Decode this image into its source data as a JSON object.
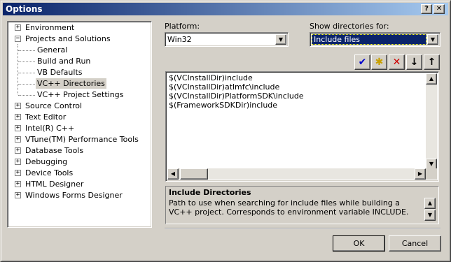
{
  "window": {
    "title": "Options",
    "help_btn": "?",
    "close_btn": "✕"
  },
  "tree": {
    "items": [
      {
        "label": "Environment",
        "expander": "+"
      },
      {
        "label": "Projects and Solutions",
        "expander": "−"
      },
      {
        "label": "General"
      },
      {
        "label": "Build and Run"
      },
      {
        "label": "VB Defaults"
      },
      {
        "label": "VC++ Directories"
      },
      {
        "label": "VC++ Project Settings"
      },
      {
        "label": "Source Control",
        "expander": "+"
      },
      {
        "label": "Text Editor",
        "expander": "+"
      },
      {
        "label": "Intel(R) C++",
        "expander": "+"
      },
      {
        "label": "VTune(TM) Performance Tools",
        "expander": "+"
      },
      {
        "label": "Database Tools",
        "expander": "+"
      },
      {
        "label": "Debugging",
        "expander": "+"
      },
      {
        "label": "Device Tools",
        "expander": "+"
      },
      {
        "label": "HTML Designer",
        "expander": "+"
      },
      {
        "label": "Windows Forms Designer",
        "expander": "+"
      }
    ]
  },
  "platform": {
    "label": "Platform:",
    "value": "Win32"
  },
  "show_dirs": {
    "label": "Show directories for:",
    "value": "Include files"
  },
  "toolbar": {
    "check": "✔",
    "new_folder": "✱",
    "delete": "✕",
    "down": "↓",
    "up": "↑"
  },
  "directories": [
    "$(VCInstallDir)include",
    "$(VCInstallDir)atlmfc\\include",
    "$(VCInstallDir)PlatformSDK\\include",
    "$(FrameworkSDKDir)include"
  ],
  "description": {
    "title": "Include Directories",
    "text": "Path to use when searching for include files while building a VC++ project.  Corresponds to environment variable INCLUDE."
  },
  "buttons": {
    "ok": "OK",
    "cancel": "Cancel"
  },
  "icons": {
    "dropdown": "▼",
    "scroll_up": "▲",
    "scroll_down": "▼",
    "scroll_left": "◀",
    "scroll_right": "▶"
  }
}
